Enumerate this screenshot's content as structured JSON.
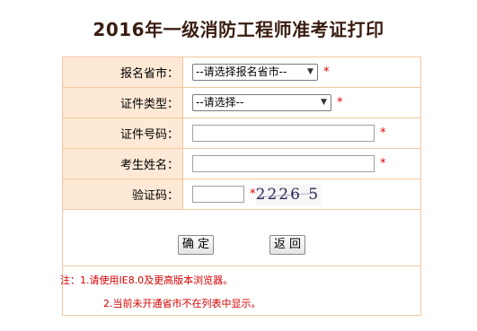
{
  "title": "2016年一级消防工程师准考证打印",
  "form": {
    "province": {
      "label": "报名省市：",
      "selected": "--请选择报名省市--"
    },
    "cert_type": {
      "label": "证件类型：",
      "selected": "--请选择--"
    },
    "cert_number": {
      "label": "证件号码：",
      "value": ""
    },
    "name": {
      "label": "考生姓名：",
      "value": ""
    },
    "captcha": {
      "label": "验证码：",
      "value": "",
      "image_text": "2226 5"
    },
    "required_mark": "*"
  },
  "buttons": {
    "confirm": "确 定",
    "back": "返 回"
  },
  "notes": {
    "note1": "注：1.请使用IE8.0及更高版本浏览器。",
    "note2": "2.当前未开通省市不在列表中显示。"
  }
}
